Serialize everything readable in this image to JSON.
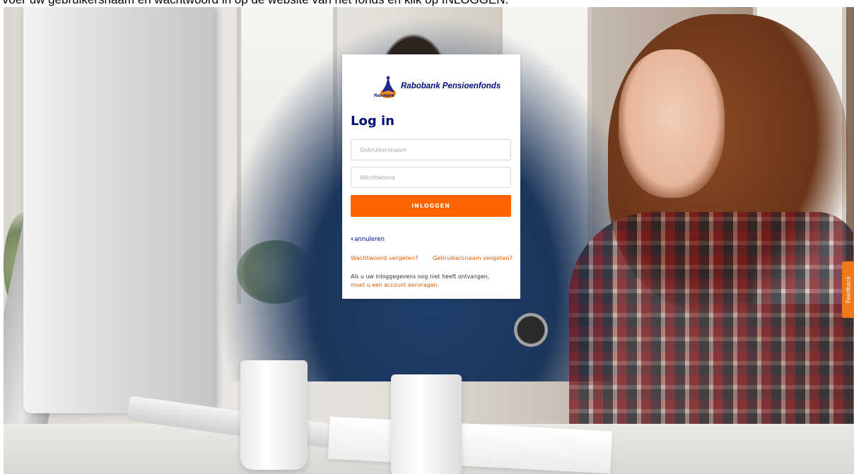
{
  "instruction": {
    "text": "Voer uw gebruikersnaam en wachtwoord in op de website van het fonds en klik op INLOGGEN."
  },
  "logo": {
    "brand_name": "Rabobank Pensioenfonds",
    "small_text": "Rabobank"
  },
  "login": {
    "title": "Log in",
    "username_placeholder": "Gebruikersnaam",
    "password_placeholder": "Wachtwoord",
    "submit_label": "INLOGGEN",
    "cancel_label": "annuleren",
    "forgot_password": "Wachtwoord vergeten?",
    "forgot_username": "Gebruikersnaam vergeten?",
    "note_text": "Als u uw inloggegevens nog niet heeft ontvangen,",
    "note_link": "moet u een account aanvragen."
  },
  "feedback": {
    "label": "Feedback"
  },
  "colors": {
    "brand_blue": "#000d7b",
    "accent_orange": "#fd6400",
    "link_orange": "#e45c00"
  }
}
